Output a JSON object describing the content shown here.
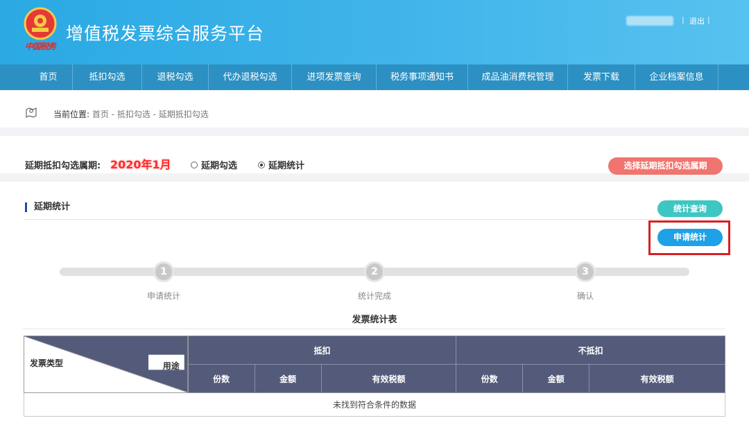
{
  "header": {
    "site_title": "增值税发票综合服务平台",
    "logout": "退出",
    "separator": "|",
    "emblem_signature": "中国税务"
  },
  "nav": {
    "items": [
      {
        "label": "首页"
      },
      {
        "label": "抵扣勾选"
      },
      {
        "label": "退税勾选"
      },
      {
        "label": "代办退税勾选"
      },
      {
        "label": "进项发票查询"
      },
      {
        "label": "税务事项通知书"
      },
      {
        "label": "成品油消费税管理"
      },
      {
        "label": "发票下载"
      },
      {
        "label": "企业档案信息"
      }
    ]
  },
  "breadcrumb": {
    "label": "当前位置:",
    "path": "首页 - 抵扣勾选 - 延期抵扣勾选"
  },
  "period": {
    "label": "延期抵扣勾选属期:",
    "value": "2020年1月",
    "options": [
      {
        "label": "延期勾选",
        "selected": false
      },
      {
        "label": "延期统计",
        "selected": true
      }
    ],
    "select_button": "选择延期抵扣勾选属期"
  },
  "section": {
    "title": "延期统计",
    "query_button": "统计查询",
    "apply_button": "申请统计"
  },
  "steps": [
    {
      "number": "1",
      "label": "申请统计"
    },
    {
      "number": "2",
      "label": "统计完成"
    },
    {
      "number": "3",
      "label": "确认"
    }
  ],
  "table": {
    "title": "发票统计表",
    "corner_left": "发票类型",
    "corner_right": "用途",
    "groups": [
      "抵扣",
      "不抵扣"
    ],
    "columns": [
      "份数",
      "金额",
      "有效税额",
      "份数",
      "金额",
      "有效税额"
    ],
    "empty_text": "未找到符合条件的数据"
  },
  "colors": {
    "header_blue": "#2aa9e3",
    "nav_blue": "#2c90c2",
    "period_red": "#ff2a2a",
    "select_button": "#f0746f",
    "query_button": "#3ec6c2",
    "apply_button": "#1ea1e6",
    "highlight": "#d81f1f",
    "table_header": "#545b7a"
  }
}
